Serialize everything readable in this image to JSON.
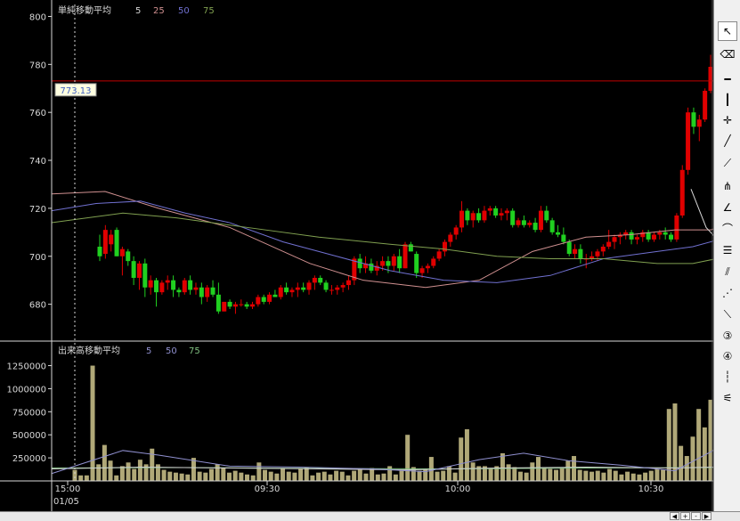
{
  "price_panel": {
    "title": "単純移動平均",
    "ma_periods": [
      "5",
      "25",
      "50",
      "75"
    ],
    "current_price_label": "773.13",
    "current_price": 773.13,
    "y_ticks": [
      "800",
      "780",
      "760",
      "740",
      "720",
      "700",
      "680"
    ]
  },
  "volume_panel": {
    "title": "出来高移動平均",
    "ma_periods": [
      "5",
      "50",
      "75"
    ],
    "y_ticks": [
      "1250000",
      "1000000",
      "750000",
      "500000",
      "250000"
    ]
  },
  "x_axis": {
    "time_labels": [
      "15:00",
      "09:30",
      "10:00",
      "10:30"
    ],
    "date_label": "01/05"
  },
  "colors": {
    "background": "#000000",
    "up_candle": "#e00000",
    "down_candle": "#20d020",
    "ma5_price": "#d8d8d8",
    "ma25_price": "#d09090",
    "ma50_price": "#7070d0",
    "ma75_price": "#80a050",
    "ma5_volume": "#9090d0",
    "ma50_volume": "#d0d0d0",
    "ma75_volume": "#80c080",
    "volume_bar": "#b0a878",
    "price_line": "#c00000",
    "grid": "#d8d8d8"
  },
  "toolbar": {
    "tools": [
      "cursor-icon",
      "eraser-icon",
      "horizontal-line-icon",
      "vertical-line-icon",
      "cross-line-icon",
      "trend-line-icon",
      "fan-line-icon",
      "fibonacci-fan-icon",
      "fibonacci-f-icon",
      "fibonacci-arc-icon",
      "fibonacci-retracement-icon",
      "parallel-line-icon",
      "gann-fan-icon",
      "regression-line-icon",
      "cycle-3-icon",
      "cycle-4-icon",
      "time-cycle-icon",
      "pattern-icon"
    ]
  },
  "chart_data": {
    "type": "candlestick",
    "price": {
      "ylim": [
        665,
        805
      ],
      "candles": [
        [
          704,
          709,
          698,
          700
        ],
        [
          701,
          713,
          699,
          711
        ],
        [
          705,
          711,
          702,
          709
        ],
        [
          711,
          712,
          700,
          700
        ],
        [
          700,
          704,
          692,
          703
        ],
        [
          702,
          703,
          696,
          698
        ],
        [
          698,
          700,
          688,
          691
        ],
        [
          691,
          698,
          686,
          697
        ],
        [
          697,
          699,
          683,
          687
        ],
        [
          687,
          692,
          684,
          690
        ],
        [
          690,
          691,
          679,
          685
        ],
        [
          685,
          690,
          684,
          689
        ],
        [
          689,
          692,
          686,
          690
        ],
        [
          690,
          692,
          683,
          686
        ],
        [
          686,
          687,
          683,
          685
        ],
        [
          685,
          691,
          684,
          690
        ],
        [
          690,
          692,
          684,
          686
        ],
        [
          686,
          689,
          684,
          687
        ],
        [
          687,
          689,
          680,
          683
        ],
        [
          683,
          688,
          681,
          687
        ],
        [
          687,
          690,
          683,
          684
        ],
        [
          684,
          689,
          676,
          677
        ],
        [
          677,
          681,
          677,
          681
        ],
        [
          681,
          682,
          678,
          679
        ],
        [
          679,
          681,
          676,
          680
        ],
        [
          680,
          682,
          679,
          680
        ],
        [
          680,
          681,
          678,
          679
        ],
        [
          679,
          681,
          678,
          680
        ],
        [
          680,
          684,
          679,
          683
        ],
        [
          683,
          684,
          680,
          681
        ],
        [
          681,
          685,
          680,
          684
        ],
        [
          684,
          686,
          683,
          683
        ],
        [
          683,
          688,
          682,
          687
        ],
        [
          687,
          689,
          684,
          685
        ],
        [
          685,
          687,
          683,
          686
        ],
        [
          686,
          689,
          683,
          687
        ],
        [
          687,
          689,
          685,
          686
        ],
        [
          686,
          690,
          684,
          689
        ],
        [
          689,
          692,
          686,
          691
        ],
        [
          691,
          692,
          688,
          689
        ],
        [
          689,
          690,
          685,
          686
        ],
        [
          686,
          688,
          684,
          686
        ],
        [
          686,
          688,
          684,
          687
        ],
        [
          687,
          689,
          685,
          688
        ],
        [
          688,
          692,
          686,
          690
        ],
        [
          690,
          700,
          688,
          699
        ],
        [
          699,
          701,
          693,
          695
        ],
        [
          695,
          700,
          693,
          697
        ],
        [
          697,
          699,
          693,
          694
        ],
        [
          694,
          698,
          692,
          696
        ],
        [
          696,
          700,
          694,
          698
        ],
        [
          698,
          700,
          693,
          696
        ],
        [
          696,
          701,
          694,
          700
        ],
        [
          700,
          703,
          693,
          695
        ],
        [
          695,
          706,
          695,
          705
        ],
        [
          705,
          706,
          702,
          702
        ],
        [
          701,
          702,
          691,
          693
        ],
        [
          693,
          696,
          691,
          695
        ],
        [
          695,
          697,
          693,
          696
        ],
        [
          696,
          700,
          695,
          699
        ],
        [
          699,
          703,
          698,
          702
        ],
        [
          702,
          707,
          700,
          706
        ],
        [
          706,
          710,
          704,
          709
        ],
        [
          709,
          713,
          707,
          712
        ],
        [
          712,
          723,
          710,
          719
        ],
        [
          719,
          720,
          713,
          715
        ],
        [
          715,
          719,
          712,
          718
        ],
        [
          718,
          720,
          714,
          715
        ],
        [
          715,
          721,
          714,
          719
        ],
        [
          719,
          721,
          717,
          720
        ],
        [
          720,
          721,
          716,
          717
        ],
        [
          717,
          720,
          715,
          718
        ],
        [
          718,
          720,
          715,
          719
        ],
        [
          719,
          720,
          712,
          713
        ],
        [
          713,
          716,
          712,
          715
        ],
        [
          715,
          717,
          712,
          713
        ],
        [
          713,
          715,
          712,
          714
        ],
        [
          714,
          716,
          710,
          711
        ],
        [
          711,
          721,
          710,
          719
        ],
        [
          719,
          721,
          714,
          715
        ],
        [
          715,
          716,
          709,
          710
        ],
        [
          710,
          713,
          708,
          709
        ],
        [
          709,
          712,
          705,
          706
        ],
        [
          706,
          707,
          700,
          701
        ],
        [
          701,
          705,
          699,
          703
        ],
        [
          703,
          705,
          697,
          699
        ],
        [
          699,
          701,
          695,
          699
        ],
        [
          699,
          702,
          698,
          700
        ],
        [
          700,
          703,
          698,
          702
        ],
        [
          702,
          705,
          700,
          704
        ],
        [
          704,
          711,
          703,
          706
        ],
        [
          706,
          709,
          703,
          708
        ],
        [
          708,
          710,
          705,
          709
        ],
        [
          709,
          711,
          707,
          710
        ],
        [
          710,
          711,
          705,
          707
        ],
        [
          707,
          709,
          705,
          708
        ],
        [
          708,
          711,
          706,
          710
        ],
        [
          710,
          711,
          706,
          707
        ],
        [
          707,
          710,
          706,
          709
        ],
        [
          709,
          711,
          707,
          710
        ],
        [
          710,
          712,
          707,
          709
        ],
        [
          709,
          710,
          706,
          707
        ],
        [
          707,
          718,
          706,
          717
        ],
        [
          717,
          738,
          716,
          736
        ],
        [
          736,
          762,
          734,
          760
        ],
        [
          760,
          762,
          751,
          754
        ],
        [
          754,
          759,
          748,
          757
        ],
        [
          757,
          770,
          756,
          769
        ],
        [
          769,
          784,
          768,
          779
        ]
      ],
      "ma5": [
        [
          718,
          728
        ],
        [
          735,
          712
        ],
        [
          745,
          708
        ],
        [
          760,
          738
        ],
        [
          790,
          760
        ]
      ],
      "ma25": [
        [
          0,
          726
        ],
        [
          60,
          727
        ],
        [
          120,
          720
        ],
        [
          200,
          712
        ],
        [
          290,
          697
        ],
        [
          350,
          690
        ],
        [
          420,
          687
        ],
        [
          480,
          690
        ],
        [
          540,
          702
        ],
        [
          600,
          708
        ],
        [
          650,
          709
        ],
        [
          700,
          711
        ],
        [
          740,
          711
        ],
        [
          760,
          713
        ],
        [
          790,
          721
        ]
      ],
      "ma50": [
        [
          0,
          719
        ],
        [
          50,
          722
        ],
        [
          100,
          723
        ],
        [
          150,
          718
        ],
        [
          200,
          714
        ],
        [
          260,
          706
        ],
        [
          320,
          700
        ],
        [
          380,
          694
        ],
        [
          440,
          690
        ],
        [
          500,
          689
        ],
        [
          560,
          692
        ],
        [
          620,
          699
        ],
        [
          680,
          702
        ],
        [
          720,
          704
        ],
        [
          760,
          708
        ],
        [
          790,
          716
        ]
      ],
      "ma75": [
        [
          0,
          714
        ],
        [
          40,
          716
        ],
        [
          80,
          718
        ],
        [
          140,
          716
        ],
        [
          220,
          712
        ],
        [
          300,
          708
        ],
        [
          380,
          705
        ],
        [
          440,
          703
        ],
        [
          500,
          700
        ],
        [
          560,
          699
        ],
        [
          620,
          699
        ],
        [
          680,
          697
        ],
        [
          720,
          697
        ],
        [
          760,
          700
        ],
        [
          790,
          706
        ]
      ]
    },
    "volume": {
      "ylim": [
        0,
        1400000
      ],
      "bars": [
        120000,
        60000,
        60000,
        1250000,
        180000,
        390000,
        220000,
        60000,
        160000,
        200000,
        130000,
        230000,
        180000,
        350000,
        180000,
        120000,
        100000,
        90000,
        80000,
        70000,
        250000,
        100000,
        90000,
        130000,
        180000,
        140000,
        90000,
        110000,
        90000,
        70000,
        60000,
        200000,
        120000,
        100000,
        80000,
        140000,
        100000,
        90000,
        130000,
        150000,
        60000,
        90000,
        100000,
        70000,
        110000,
        100000,
        60000,
        110000,
        120000,
        80000,
        140000,
        70000,
        80000,
        160000,
        70000,
        110000,
        500000,
        150000,
        110000,
        120000,
        260000,
        100000,
        110000,
        160000,
        90000,
        470000,
        560000,
        200000,
        160000,
        160000,
        140000,
        160000,
        300000,
        180000,
        150000,
        100000,
        90000,
        200000,
        260000,
        150000,
        130000,
        120000,
        140000,
        220000,
        270000,
        120000,
        110000,
        100000,
        110000,
        90000,
        130000,
        110000,
        70000,
        100000,
        80000,
        70000,
        90000,
        110000,
        130000,
        120000,
        780000,
        840000,
        380000,
        270000,
        480000,
        780000,
        580000,
        880000
      ],
      "ma5": [
        [
          0,
          80000
        ],
        [
          80,
          330000
        ],
        [
          120,
          280000
        ],
        [
          200,
          160000
        ],
        [
          280,
          150000
        ],
        [
          360,
          130000
        ],
        [
          420,
          100000
        ],
        [
          480,
          230000
        ],
        [
          530,
          300000
        ],
        [
          580,
          220000
        ],
        [
          640,
          170000
        ],
        [
          700,
          110000
        ],
        [
          745,
          340000
        ],
        [
          770,
          460000
        ],
        [
          800,
          520000
        ]
      ],
      "ma50": [
        [
          0,
          130000
        ],
        [
          100,
          150000
        ],
        [
          200,
          140000
        ],
        [
          300,
          130000
        ],
        [
          400,
          120000
        ],
        [
          500,
          140000
        ],
        [
          600,
          150000
        ],
        [
          700,
          140000
        ],
        [
          745,
          150000
        ],
        [
          800,
          200000
        ]
      ],
      "ma75": [
        [
          0,
          140000
        ],
        [
          150,
          145000
        ],
        [
          300,
          135000
        ],
        [
          450,
          130000
        ],
        [
          600,
          140000
        ],
        [
          745,
          145000
        ],
        [
          800,
          170000
        ]
      ]
    }
  },
  "bottombar": {
    "buttons": [
      "◀",
      "+",
      "-",
      "▶"
    ]
  }
}
